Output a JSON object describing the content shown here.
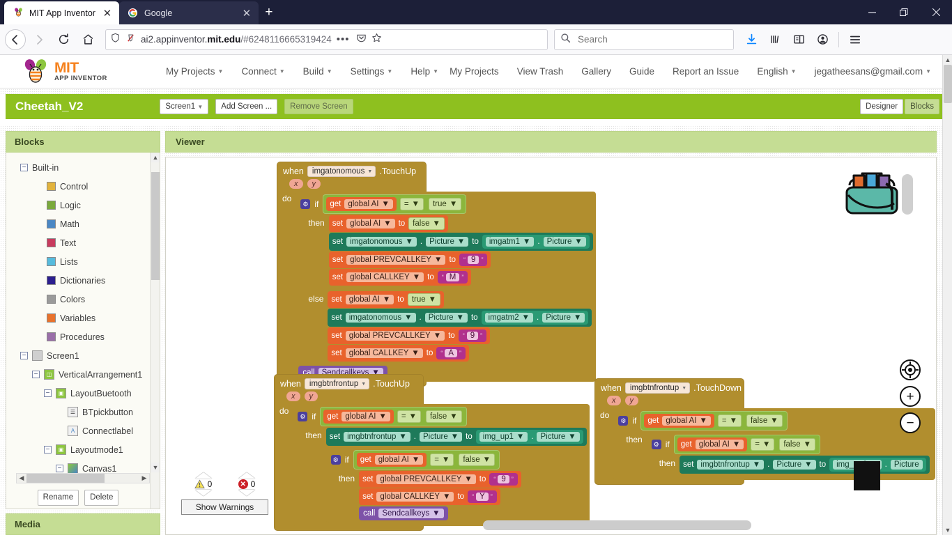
{
  "browser": {
    "tabs": [
      {
        "title": "MIT App Inventor",
        "favicon": "app-inventor-icon",
        "active": true
      },
      {
        "title": "Google",
        "favicon": "google-icon",
        "active": false
      }
    ],
    "new_tab_label": "+",
    "window_controls": {
      "minimize": "–",
      "maximize": "❐",
      "close": "✕"
    },
    "nav": {
      "back": "←",
      "forward": "→",
      "reload": "↻",
      "home": "⌂",
      "shield_icon": "shield-icon",
      "tracking_icon": "tracking-protection-off-icon"
    },
    "url": {
      "host_lead": "ai2.appinventor.",
      "host_bold": "mit.edu",
      "path": "/#6248116665319424"
    },
    "url_actions": {
      "more": "•••",
      "pocket": "pocket-icon",
      "bookmark": "star-icon"
    },
    "search": {
      "placeholder": "Search",
      "icon": "search-icon"
    },
    "right_icons": [
      "downloads-icon",
      "library-icon",
      "sidebar-icon",
      "account-icon",
      "menu-icon"
    ]
  },
  "app": {
    "logo": {
      "mit": "MIT",
      "sub": "APP INVENTOR"
    },
    "menu_left": [
      {
        "label": "My Projects",
        "caret": "▼"
      },
      {
        "label": "Connect",
        "caret": "▼"
      },
      {
        "label": "Build",
        "caret": "▼"
      },
      {
        "label": "Settings",
        "caret": "▼"
      },
      {
        "label": "Help",
        "caret": "▼"
      }
    ],
    "menu_right": [
      {
        "label": "My Projects",
        "caret": ""
      },
      {
        "label": "View Trash",
        "caret": ""
      },
      {
        "label": "Gallery",
        "caret": ""
      },
      {
        "label": "Guide",
        "caret": ""
      },
      {
        "label": "Report an Issue",
        "caret": ""
      },
      {
        "label": "English",
        "caret": "▼"
      },
      {
        "label": "jegatheesans@gmail.com",
        "caret": "▼"
      }
    ],
    "project": {
      "name": "Cheetah_V2",
      "screen_select": "Screen1",
      "screen_caret": "▼",
      "add_screen": "Add Screen ...",
      "remove_screen": "Remove Screen",
      "designer": "Designer",
      "blocks": "Blocks"
    }
  },
  "palette": {
    "title": "Blocks",
    "builtin": {
      "label": "Built-in",
      "toggle": "−"
    },
    "builtin_items": [
      {
        "label": "Control",
        "color": "#e2b33c"
      },
      {
        "label": "Logic",
        "color": "#7aa93c"
      },
      {
        "label": "Math",
        "color": "#4a87c4"
      },
      {
        "label": "Text",
        "color": "#c83b5e"
      },
      {
        "label": "Lists",
        "color": "#56bbdd"
      },
      {
        "label": "Dictionaries",
        "color": "#2c1f8f"
      },
      {
        "label": "Colors",
        "color": "#9a9a9a"
      },
      {
        "label": "Variables",
        "color": "#e8722c"
      },
      {
        "label": "Procedures",
        "color": "#9a6fa8"
      }
    ],
    "tree": [
      {
        "label": "Screen1",
        "indent": 0,
        "toggle": "−",
        "icon": "screen-icon"
      },
      {
        "label": "VerticalArrangement1",
        "indent": 1,
        "toggle": "−",
        "icon": "vertical-arrangement-icon"
      },
      {
        "label": "LayoutBuetooth",
        "indent": 2,
        "toggle": "−",
        "icon": "horizontal-arrangement-icon"
      },
      {
        "label": "BTpickbutton",
        "indent": 3,
        "toggle": "",
        "icon": "listpicker-icon"
      },
      {
        "label": "Connectlabel",
        "indent": 3,
        "toggle": "",
        "icon": "label-icon"
      },
      {
        "label": "Layoutmode1",
        "indent": 2,
        "toggle": "−",
        "icon": "horizontal-arrangement-icon"
      },
      {
        "label": "Canvas1",
        "indent": 3,
        "toggle": "−",
        "icon": "canvas-icon"
      }
    ],
    "rename": "Rename",
    "delete": "Delete",
    "media_title": "Media"
  },
  "viewer": {
    "title": "Viewer",
    "warnings": {
      "warn_count": "0",
      "error_count": "0",
      "show_warnings": "Show Warnings"
    },
    "zoom_controls": {
      "center": "☉",
      "zoom_in": "+",
      "zoom_out": "−"
    },
    "backpack_icon": "backpack-icon"
  },
  "blocks": {
    "b1": {
      "when": "when",
      "component": "imgatonomous",
      "event": ".TouchUp",
      "params": [
        "x",
        "y"
      ],
      "do": "do",
      "if": "if",
      "then": "then",
      "else": "else",
      "cond": {
        "get": "get",
        "var": "global AI",
        "op": "=",
        "value": "true"
      },
      "then_rows": [
        {
          "kind": "set-var",
          "set": "set",
          "var": "global AI",
          "to": "to",
          "value": "false",
          "value_kind": "bool"
        },
        {
          "kind": "set-comp",
          "set": "set",
          "comp": "imgatonomous",
          "prop": "Picture",
          "to": "to",
          "src_comp": "imgatm1",
          "src_prop": "Picture"
        },
        {
          "kind": "set-text",
          "set": "set",
          "var": "global PREVCALLKEY",
          "to": "to",
          "value": "9"
        },
        {
          "kind": "set-text",
          "set": "set",
          "var": "global CALLKEY",
          "to": "to",
          "value": "M"
        }
      ],
      "else_rows": [
        {
          "kind": "set-var",
          "set": "set",
          "var": "global AI",
          "to": "to",
          "value": "true",
          "value_kind": "bool"
        },
        {
          "kind": "set-comp",
          "set": "set",
          "comp": "imgatonomous",
          "prop": "Picture",
          "to": "to",
          "src_comp": "imgatm2",
          "src_prop": "Picture"
        },
        {
          "kind": "set-text",
          "set": "set",
          "var": "global PREVCALLKEY",
          "to": "to",
          "value": "9"
        },
        {
          "kind": "set-text",
          "set": "set",
          "var": "global CALLKEY",
          "to": "to",
          "value": "A"
        }
      ],
      "call": {
        "call": "call",
        "proc": "Sendcallkeys"
      }
    },
    "b2": {
      "when": "when",
      "component": "imgbtnfrontup",
      "event": ".TouchUp",
      "params": [
        "x",
        "y"
      ],
      "do": "do",
      "if": "if",
      "then": "then",
      "cond": {
        "get": "get",
        "var": "global AI",
        "op": "=",
        "value": "false"
      },
      "set_row": {
        "set": "set",
        "comp": "imgbtnfrontup",
        "prop": "Picture",
        "to": "to",
        "src_comp": "img_up1",
        "src_prop": "Picture"
      },
      "inner_if": "if",
      "inner_then": "then",
      "inner_cond": {
        "get": "get",
        "var": "global AI",
        "op": "=",
        "value": "false"
      },
      "inner_rows": [
        {
          "kind": "set-text",
          "set": "set",
          "var": "global PREVCALLKEY",
          "to": "to",
          "value": "9"
        },
        {
          "kind": "set-text",
          "set": "set",
          "var": "global CALLKEY",
          "to": "to",
          "value": "Y"
        }
      ],
      "call": {
        "call": "call",
        "proc": "Sendcallkeys"
      }
    },
    "b3": {
      "when": "when",
      "component": "imgbtnfrontup",
      "event": ".TouchDown",
      "params": [
        "x",
        "y"
      ],
      "do": "do",
      "if": "if",
      "then": "then",
      "cond": {
        "get": "get",
        "var": "global AI",
        "op": "=",
        "value": "false"
      },
      "inner_if": "if",
      "inner_then": "then",
      "inner_cond": {
        "get": "get",
        "var": "global AI",
        "op": "=",
        "value": "false"
      },
      "set_row": {
        "set": "set",
        "comp": "imgbtnfrontup",
        "prop": "Picture",
        "to": "to",
        "src_comp": "img_up2",
        "src_prop": "Picture"
      }
    }
  },
  "colors": {
    "green_accent": "#8ec01f",
    "panel_head": "#c5dd94",
    "event_block": "#b18e2e",
    "logic_block": "#8bb63c",
    "variable_block": "#e8622c",
    "component_block": "#1e7a5a",
    "text_block": "#b1308d",
    "procedure_block": "#7d52a8"
  }
}
